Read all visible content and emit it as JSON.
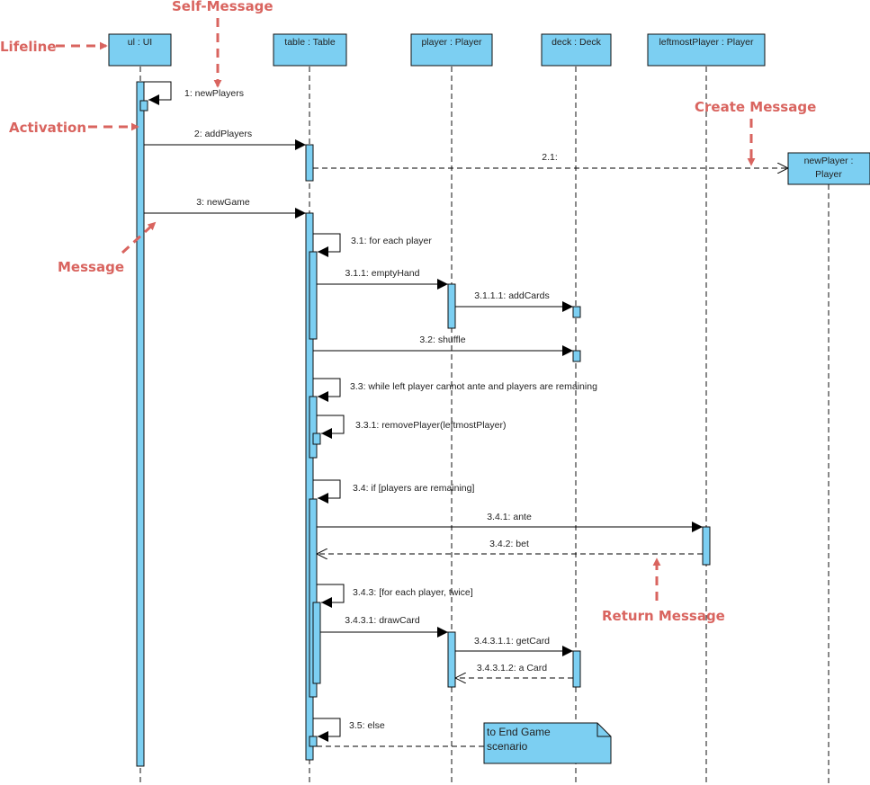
{
  "colors": {
    "fill": "#7ccff2",
    "stroke": "#111111",
    "annotation": "#d9645f",
    "text": "#222222"
  },
  "lifelines": [
    {
      "id": "ui",
      "label": "ul : UI"
    },
    {
      "id": "table",
      "label": "table : Table"
    },
    {
      "id": "player",
      "label": "player : Player"
    },
    {
      "id": "deck",
      "label": "deck : Deck"
    },
    {
      "id": "leftmost",
      "label": "leftmostPlayer : Player"
    },
    {
      "id": "newPlayer",
      "label_line1": "newPlayer :",
      "label_line2": "Player"
    }
  ],
  "messages": [
    {
      "id": "m1",
      "label": "1: newPlayers",
      "type": "self"
    },
    {
      "id": "m2",
      "label": "2: addPlayers",
      "type": "sync"
    },
    {
      "id": "m21",
      "label": "2.1:",
      "type": "create"
    },
    {
      "id": "m3",
      "label": "3: newGame",
      "type": "sync"
    },
    {
      "id": "m31",
      "label": "3.1: for each player",
      "type": "self"
    },
    {
      "id": "m311",
      "label": "3.1.1: emptyHand",
      "type": "sync"
    },
    {
      "id": "m3111",
      "label": "3.1.1.1: addCards",
      "type": "sync"
    },
    {
      "id": "m32",
      "label": "3.2: shuffle",
      "type": "sync"
    },
    {
      "id": "m33",
      "label": "3.3: while left player cannot ante and players are remaining",
      "type": "self"
    },
    {
      "id": "m331",
      "label": "3.3.1: removePlayer(leftmostPlayer)",
      "type": "self"
    },
    {
      "id": "m34",
      "label": "3.4: if [players are remaining]",
      "type": "self"
    },
    {
      "id": "m341",
      "label": "3.4.1: ante",
      "type": "sync"
    },
    {
      "id": "m342",
      "label": "3.4.2: bet",
      "type": "return"
    },
    {
      "id": "m343",
      "label": "3.4.3: [for each player, twice]",
      "type": "self"
    },
    {
      "id": "m3431",
      "label": "3.4.3.1: drawCard",
      "type": "sync"
    },
    {
      "id": "m34311",
      "label": "3.4.3.1.1: getCard",
      "type": "sync"
    },
    {
      "id": "m34312",
      "label": "3.4.3.1.2: a Card",
      "type": "return"
    },
    {
      "id": "m35",
      "label": "3.5: else",
      "type": "self"
    }
  ],
  "note": {
    "line1": "to End Game",
    "line2": "scenario"
  },
  "annotations": {
    "lifeline": "Lifeline",
    "self_message": "Self-Message",
    "activation": "Activation",
    "create_message": "Create Message",
    "message": "Message",
    "return_message": "Return Message"
  }
}
